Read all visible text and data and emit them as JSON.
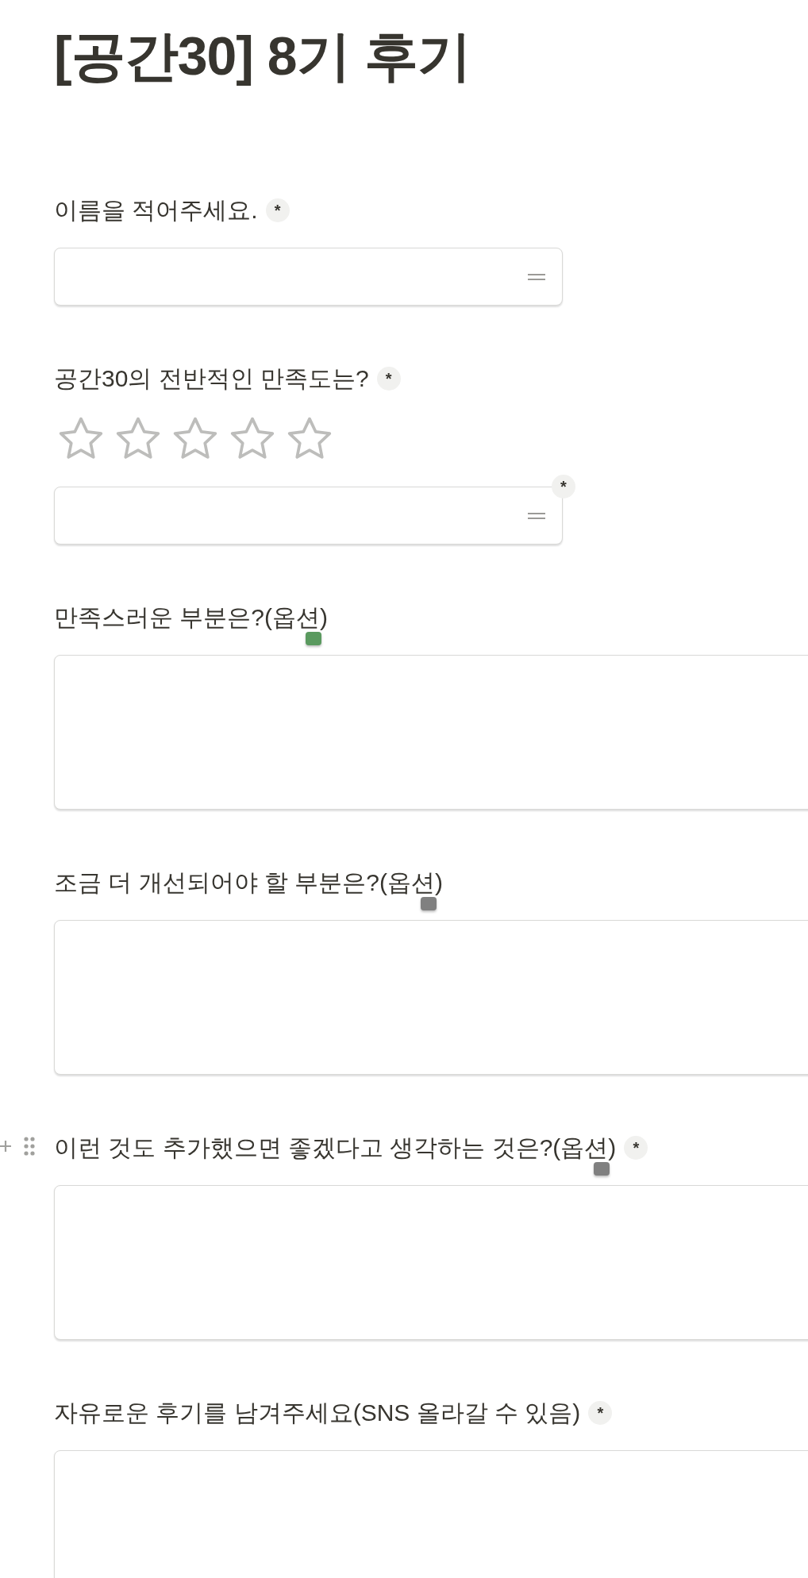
{
  "title": "[공간30] 8기 후기",
  "questions": [
    {
      "kind": "short",
      "label": "이름을 적어주세요.",
      "badge": "*"
    },
    {
      "kind": "rating",
      "label": "공간30의 전반적인 만족도는?",
      "badge": "*",
      "stars": 0,
      "field_badge": "*"
    },
    {
      "kind": "long",
      "label": "만족스러운 부분은?(옵션)",
      "color": "#5a9a5f"
    },
    {
      "kind": "long",
      "label": "조금 더 개선되어야 할 부분은?(옵션)",
      "color": "#808080"
    },
    {
      "kind": "long",
      "label": "이런 것도 추가했으면 좋겠다고 생각하는 것은?(옵션)",
      "badge": "*",
      "color": "#808080",
      "hovered": true
    },
    {
      "kind": "long",
      "label": "자유로운 후기를 남겨주세요(SNS 올라갈 수 있음)",
      "badge": "*"
    }
  ]
}
